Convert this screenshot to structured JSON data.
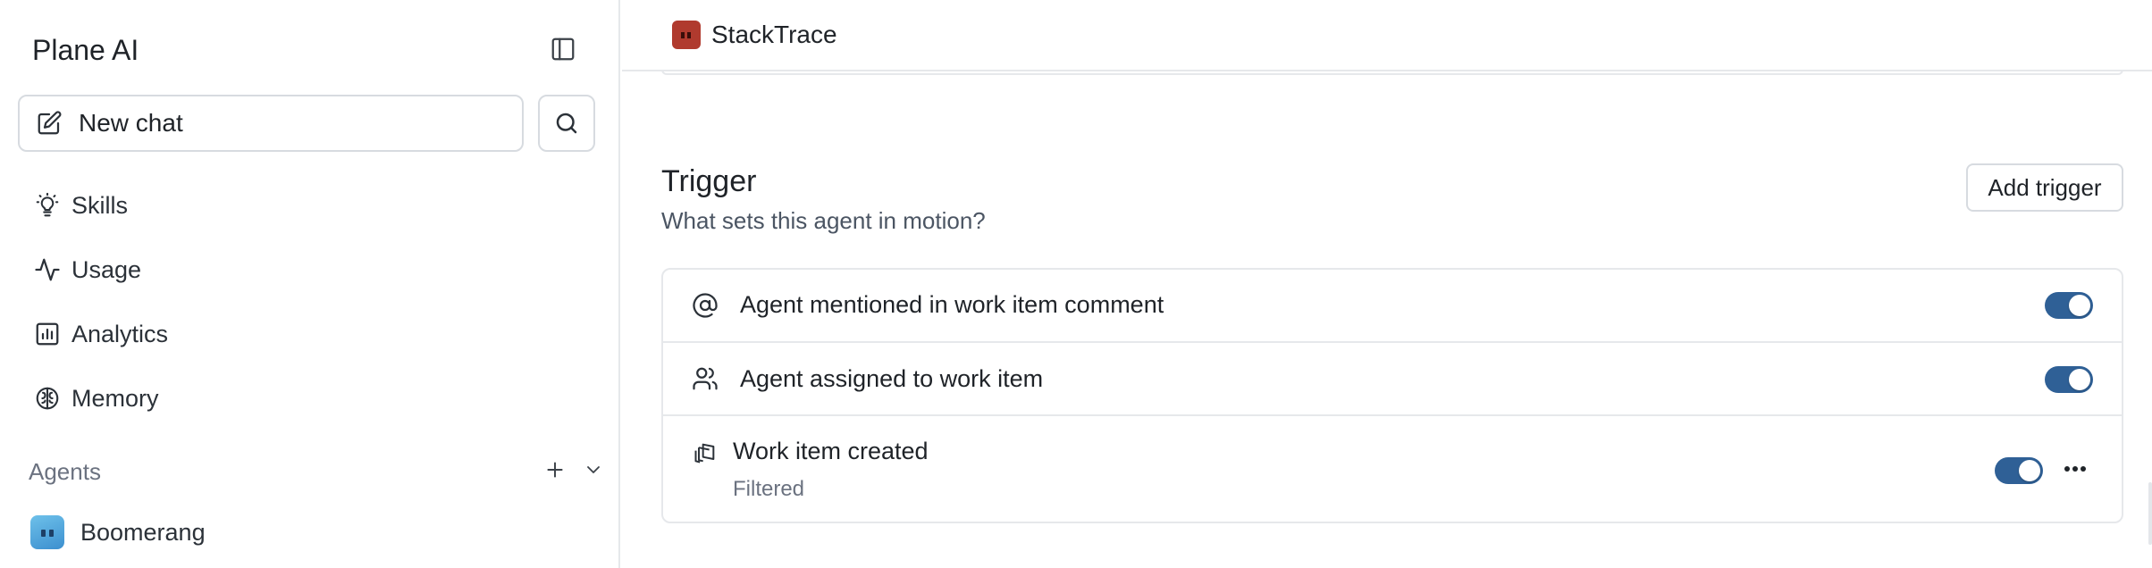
{
  "sidebar": {
    "title": "Plane AI",
    "new_chat_label": "New chat",
    "nav": [
      {
        "label": "Skills",
        "icon": "lightbulb-icon"
      },
      {
        "label": "Usage",
        "icon": "activity-icon"
      },
      {
        "label": "Analytics",
        "icon": "bar-chart-icon"
      },
      {
        "label": "Memory",
        "icon": "brain-icon"
      }
    ],
    "agents_label": "Agents",
    "agents": [
      {
        "name": "Boomerang",
        "avatar_color": "#4aa3dc"
      }
    ]
  },
  "main": {
    "breadcrumb": {
      "agent_name": "StackTrace",
      "logo_color": "#b03a2e"
    },
    "trigger": {
      "title": "Trigger",
      "subtitle": "What sets this agent in motion?",
      "add_button": "Add trigger",
      "items": [
        {
          "label": "Agent mentioned in work item comment",
          "icon": "at-sign-icon",
          "enabled": true
        },
        {
          "label": "Agent assigned to work item",
          "icon": "users-icon",
          "enabled": true
        },
        {
          "label": "Work item created",
          "sublabel": "Filtered",
          "icon": "work-items-icon",
          "enabled": true
        }
      ]
    }
  },
  "colors": {
    "toggle_on": "#2f6096",
    "border": "#e6e8eb"
  }
}
